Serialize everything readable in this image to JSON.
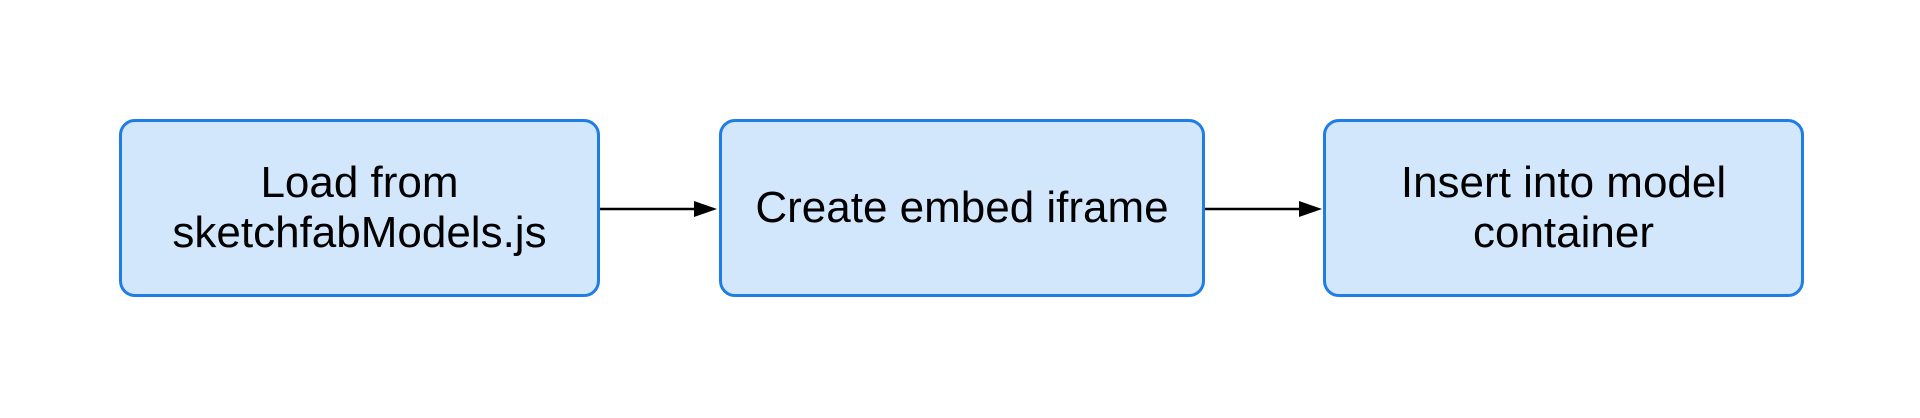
{
  "diagram": {
    "nodes": [
      {
        "id": "load",
        "lines": [
          "Load from",
          "sketchfabModels.js"
        ]
      },
      {
        "id": "create",
        "lines": [
          "Create embed iframe"
        ]
      },
      {
        "id": "insert",
        "lines": [
          "Insert into model",
          "container"
        ]
      }
    ],
    "edges": [
      {
        "from": "load",
        "to": "create"
      },
      {
        "from": "create",
        "to": "insert"
      }
    ],
    "colors": {
      "node_fill": "#d2e6fc",
      "node_border": "#1f7de6",
      "edge": "#000000",
      "text": "#000000"
    }
  }
}
